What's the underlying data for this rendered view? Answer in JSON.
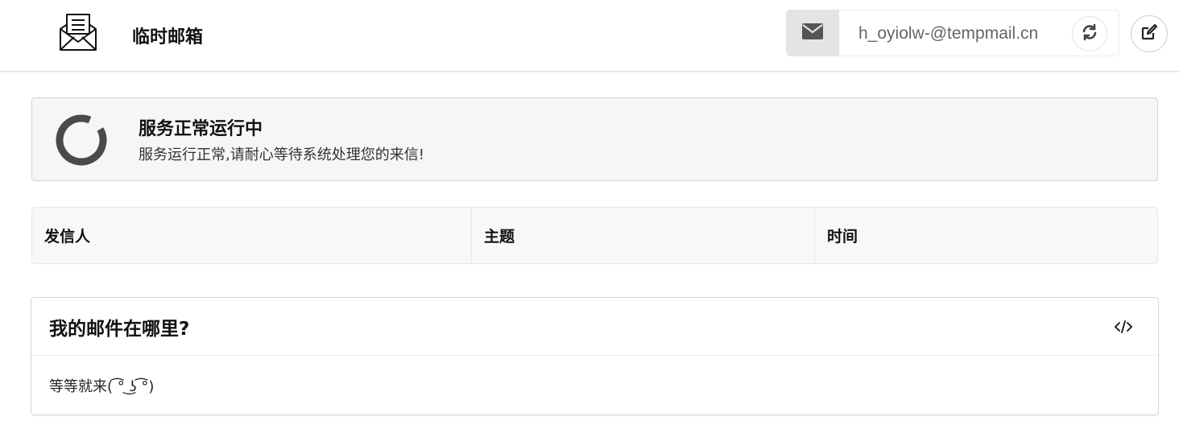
{
  "header": {
    "app_title": "临时邮箱",
    "email_address": "h_oyiolw-@tempmail.cn",
    "icons": {
      "logo": "envelope-letter-icon",
      "mail": "envelope-icon",
      "refresh": "refresh-icon",
      "edit": "edit-icon"
    }
  },
  "status": {
    "title": "服务正常运行中",
    "description": "服务运行正常,请耐心等待系统处理您的来信!",
    "icon": "spinner-icon"
  },
  "mail_table": {
    "columns": [
      "发信人",
      "主题",
      "时间"
    ],
    "rows": []
  },
  "faq": {
    "title": "我的邮件在哪里?",
    "body": "等等就来( ͡° ͜ʖ ͡°)",
    "icon": "code-icon"
  },
  "colors": {
    "addon_bg": "#e4e4e4",
    "status_bg": "#f6f6f6",
    "spinner": "#4a4a4a",
    "table_header_bg": "#f7f8fa"
  }
}
